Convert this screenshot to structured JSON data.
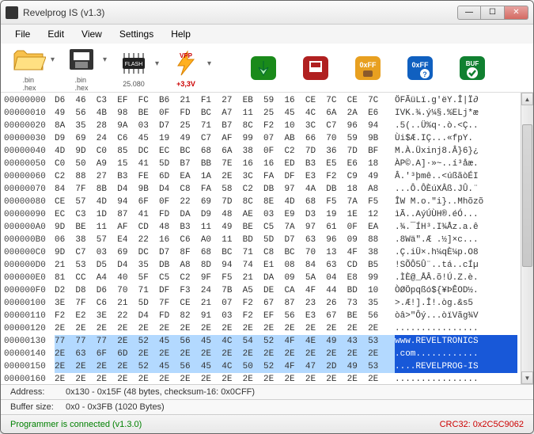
{
  "window": {
    "title": "Revelprog IS (v1.3)"
  },
  "menu": {
    "file": "File",
    "edit": "Edit",
    "view": "View",
    "settings": "Settings",
    "help": "Help"
  },
  "toolbar": {
    "open_cap": ".bin\n.hex",
    "save_cap": ".bin\n.hex",
    "flash_cap": "25.080",
    "vpp_cap": "+3,3V"
  },
  "info": {
    "address_label": "Address:",
    "address_value": "0x130 - 0x15F (48 bytes, checksum-16: 0x0CFF)",
    "buffer_label": "Buffer size:",
    "buffer_value": "0x0 - 0x3FB (1020 Bytes)"
  },
  "status": {
    "left": "Programmer is connected (v1.3.0)",
    "right": "CRC32: 0x2C5C9062"
  },
  "hex": {
    "rows": [
      {
        "a": "00000000",
        "b": "D6  46  C3  EF  FC  B6  21  F1  27  EB  59  16  CE  7C  CE  7C",
        "c": "ÖFÃüLï.g'ëY.Î|Ï∂"
      },
      {
        "a": "00000010",
        "b": "49  56  4B  98  BE  0F  FD  BC  A7  11  25  45  4C  6A  2A  E6",
        "c": "IVK.¾.ý¼§.%ELj*æ"
      },
      {
        "a": "00000020",
        "b": "8A  35  28  9A  03  D7  25  71  B7  8C  F2  10  3C  C7  96  94",
        "c": ".5(..Ü%q·.ò.<Ç.."
      },
      {
        "a": "00000030",
        "b": "D9  69  24  C6  45  19  49  C7  AF  99  07  AB  66  70  59  9B",
        "c": "Ùi$Æ.IÇ...«fpY."
      },
      {
        "a": "00000040",
        "b": "4D  9D  C0  85  DC  EC  BC  68  6A  38  0F  C2  7D  36  7D  BF",
        "c": "M.À.Üxinj8.Â}6}¿"
      },
      {
        "a": "00000050",
        "b": "C0  50  A9  15  41  5D  B7  BB  7E  16  16  ED  B3  E5  E6  18",
        "c": "ÀP©.A]·»~..í³åæ."
      },
      {
        "a": "00000060",
        "b": "C2  88  27  B3  FE  6D  EA  1A  2E  3C  FA  DF  E3  F2  C9  49",
        "c": "Â.'³þmê..<úßãòÉI"
      },
      {
        "a": "00000070",
        "b": "84  7F  8B  D4  9B  D4  C8  FA  58  C2  DB  97  4A  DB  18  A8",
        "c": "...Ô.ÔÈúXÂß.JÛ.¨"
      },
      {
        "a": "00000080",
        "b": "CE  57  4D  94  6F  0F  22  69  7D  8C  8E  4D  68  F5  7A  F5",
        "c": "ÎW M.o.\"i}..Mhõzõ"
      },
      {
        "a": "00000090",
        "b": "EC  C3  1D  87  41  FD  DA  D9  48  AE  03  E9  D3  19  1E  12",
        "c": "ìÃ..AýÚÙH®.éÓ..."
      },
      {
        "a": "000000A0",
        "b": "9D  BE  11  AF  CD  48  B3  11  49  BE  C5  7A  97  61  0F  EA",
        "c": ".¾.¯ÍH³.I¾Åz.a.ê"
      },
      {
        "a": "000000B0",
        "b": "06  38  57  E4  22  16  C6  A0  11  BD  5D  D7  63  96  09  88",
        "c": ".8Wä\".Æ .½]×c..."
      },
      {
        "a": "000000C0",
        "b": "9D  C7  03  69  DC  D7  8F  68  BC  71  C8  BC  70  13  4F  38",
        "c": ".Ç.iÜ×.h¼qÈ¼p.O8"
      },
      {
        "a": "000000D0",
        "b": "21  53  D5  D4  35  DB  A8  8D  94  74  E1  08  84  63  CD  B5",
        "c": "!SÕÔ5Û¨..tá..cÍµ"
      },
      {
        "a": "000000E0",
        "b": "81  CC  A4  40  5F  C5  C2  9F  F5  21  DA  09  5A  04  E8  99",
        "c": ".ÌÈ@_ÅÂ.õ!Ú.Z.è."
      },
      {
        "a": "000000F0",
        "b": "D2  D8  D6  70  71  DF  F3  24  7B  A5  DE  CA  4F  44  BD  10",
        "c": "ÒØÖpqßó${¥ÞÊOD½."
      },
      {
        "a": "00000100",
        "b": "3E  7F  C6  21  5D  7F  CE  21  07  F2  67  87  23  26  73  35",
        "c": ">.Æ!].Î!.òg.&s5"
      },
      {
        "a": "00000110",
        "b": "F2  E2  3E  22  D4  FD  82  91  03  F2  EF  56  E3  67  BE  56",
        "c": "òâ>\"Ôý...òïVãg¾V"
      },
      {
        "a": "00000120",
        "b": "2E  2E  2E  2E  2E  2E  2E  2E  2E  2E  2E  2E  2E  2E  2E  2E",
        "c": "................"
      },
      {
        "a": "00000130",
        "b": "77  77  77  2E  52  45  56  45  4C  54  52  4F  4E  49  43  53",
        "c": "www.REVELTRONICS",
        "sel": true
      },
      {
        "a": "00000140",
        "b": "2E  63  6F  6D  2E  2E  2E  2E  2E  2E  2E  2E  2E  2E  2E  2E",
        "c": ".com............",
        "sel": true
      },
      {
        "a": "00000150",
        "b": "2E  2E  2E  2E  52  45  56  45  4C  50  52  4F  47  2D  49  53",
        "c": "....REVELPROG-IS",
        "sel": true
      },
      {
        "a": "00000160",
        "b": "2E  2E  2E  2E  2E  2E  2E  2E  2E  2E  2E  2E  2E  2E  2E  2E",
        "c": "................"
      }
    ]
  }
}
